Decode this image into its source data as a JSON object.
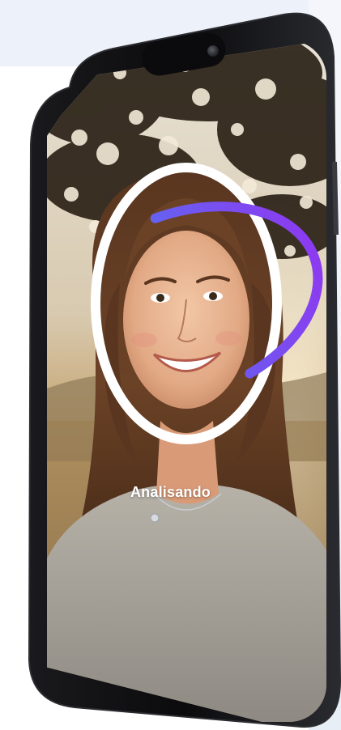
{
  "screen": {
    "status_text": "Analisando"
  },
  "scan": {
    "progress_fraction": 0.45,
    "ring_colors": {
      "start": "#2f8df0",
      "mid": "#6b5cf0",
      "end": "#8b3cf0",
      "track": "#ffffff"
    }
  },
  "colors": {
    "page_background": "#edf1fa",
    "phone_body": "#0b0b0d"
  },
  "icons": {
    "front_camera": "camera-icon"
  }
}
